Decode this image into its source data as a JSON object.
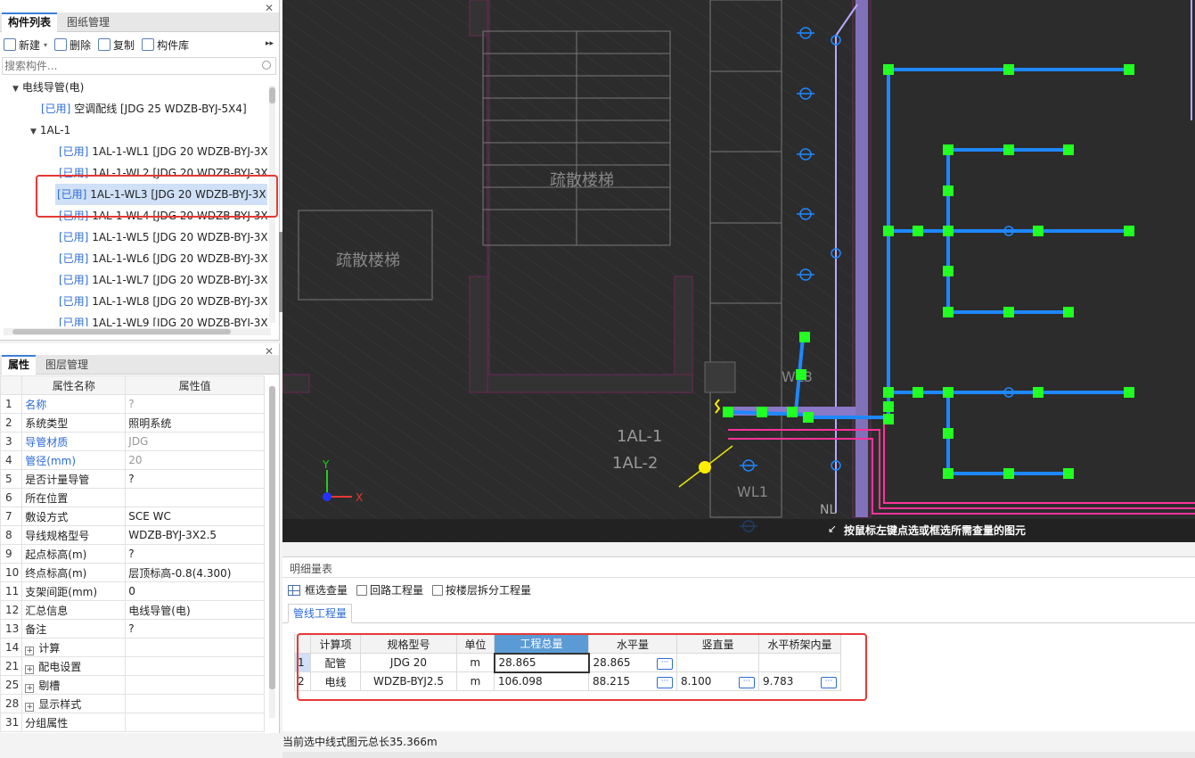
{
  "component_panel": {
    "tabs": [
      "构件列表",
      "图纸管理"
    ],
    "toolbar": {
      "new_label": "新建",
      "delete_label": "删除",
      "copy_label": "复制",
      "library_label": "构件库"
    },
    "search_placeholder": "搜索构件...",
    "tree": {
      "root": "电线导管(电)",
      "items": [
        {
          "tag": "[已用]",
          "text": " 空调配线 [JDG 25 WDZB-BYJ-5X4]"
        },
        {
          "group": "1AL-1"
        },
        {
          "tag": "[已用]",
          "text": " 1AL-1-WL1 [JDG 20 WDZB-BYJ-3X"
        },
        {
          "tag": "[已用]",
          "text": " 1AL-1-WL2 [JDG 20 WDZB-BYJ-3X"
        },
        {
          "tag": "[已用]",
          "text": " 1AL-1-WL3 [JDG 20 WDZB-BYJ-3X"
        },
        {
          "tag": "[已用]",
          "text": " 1AL-1-WL4 [JDG 20 WDZB-BYJ-3X"
        },
        {
          "tag": "[已用]",
          "text": " 1AL-1-WL5 [JDG 20 WDZB-BYJ-3X"
        },
        {
          "tag": "[已用]",
          "text": " 1AL-1-WL6 [JDG 20 WDZB-BYJ-3X"
        },
        {
          "tag": "[已用]",
          "text": " 1AL-1-WL7 [JDG 20 WDZB-BYJ-3X"
        },
        {
          "tag": "[已用]",
          "text": " 1AL-1-WL8 [JDG 20 WDZB-BYJ-3X"
        },
        {
          "tag": "[已用]",
          "text": " 1AL-1-WL9 [JDG 20 WDZB-BYJ-3X"
        }
      ]
    }
  },
  "properties_panel": {
    "tabs": [
      "属性",
      "图层管理"
    ],
    "headers": [
      "属性名称",
      "属性值"
    ],
    "rows": [
      {
        "n": "1",
        "name": "名称",
        "value": "?",
        "blue": true,
        "grey": true
      },
      {
        "n": "2",
        "name": "系统类型",
        "value": "照明系统"
      },
      {
        "n": "3",
        "name": "导管材质",
        "value": "JDG",
        "blue": true,
        "grey": true
      },
      {
        "n": "4",
        "name": "管径(mm)",
        "value": "20",
        "blue": true,
        "grey": true
      },
      {
        "n": "5",
        "name": "是否计量导管",
        "value": "?"
      },
      {
        "n": "6",
        "name": "所在位置",
        "value": ""
      },
      {
        "n": "7",
        "name": "敷设方式",
        "value": "SCE WC"
      },
      {
        "n": "8",
        "name": "导线规格型号",
        "value": "WDZB-BYJ-3X2.5"
      },
      {
        "n": "9",
        "name": "起点标高(m)",
        "value": "?"
      },
      {
        "n": "10",
        "name": "终点标高(m)",
        "value": "层顶标高-0.8(4.300)"
      },
      {
        "n": "11",
        "name": "支架间距(mm)",
        "value": "0"
      },
      {
        "n": "12",
        "name": "汇总信息",
        "value": "电线导管(电)"
      },
      {
        "n": "13",
        "name": "备注",
        "value": "?"
      },
      {
        "n": "14",
        "name": "计算",
        "value": "",
        "expand": true
      },
      {
        "n": "21",
        "name": "配电设置",
        "value": "",
        "expand": true
      },
      {
        "n": "25",
        "name": "剔槽",
        "value": "",
        "expand": true
      },
      {
        "n": "28",
        "name": "显示样式",
        "value": "",
        "expand": true
      },
      {
        "n": "31",
        "name": "分组属性",
        "value": ""
      }
    ]
  },
  "canvas": {
    "hint": "按鼠标左键点选或框选所需查量的图元",
    "labels": {
      "al1": "1AL-1",
      "al2": "1AL-2",
      "wl1": "WL1",
      "wl3": "WL3",
      "stair1": "疏散楼梯",
      "stair2": "疏散楼梯",
      "axis_x": "X",
      "axis_y": "Y",
      "nl": "NL"
    },
    "colors": {
      "background": "#2c2c2c",
      "pipe": "#1e88ff",
      "node": "#22ff22",
      "magenta": "#ff3399",
      "lavender": "#b9a8ff"
    }
  },
  "detail_panel": {
    "title": "明细量表",
    "options": {
      "box_select": "框选查量",
      "loop_qty": "回路工程量",
      "by_floor": "按楼层拆分工程量"
    },
    "tab": "管线工程量",
    "headers": [
      "计算项",
      "规格型号",
      "单位",
      "工程总量",
      "水平量",
      "竖直量",
      "水平桥架内量"
    ],
    "rows": [
      {
        "idx": "1",
        "item": "配管",
        "spec": "JDG 20",
        "unit": "m",
        "total": "28.865",
        "horizontal": "28.865",
        "vertical": "",
        "tray": ""
      },
      {
        "idx": "2",
        "item": "电线",
        "spec": "WDZB-BYJ2.5",
        "unit": "m",
        "total": "106.098",
        "horizontal": "88.215",
        "vertical": "8.100",
        "tray": "9.783"
      }
    ]
  },
  "status": {
    "text": "当前选中线式图元总长35.366m"
  }
}
